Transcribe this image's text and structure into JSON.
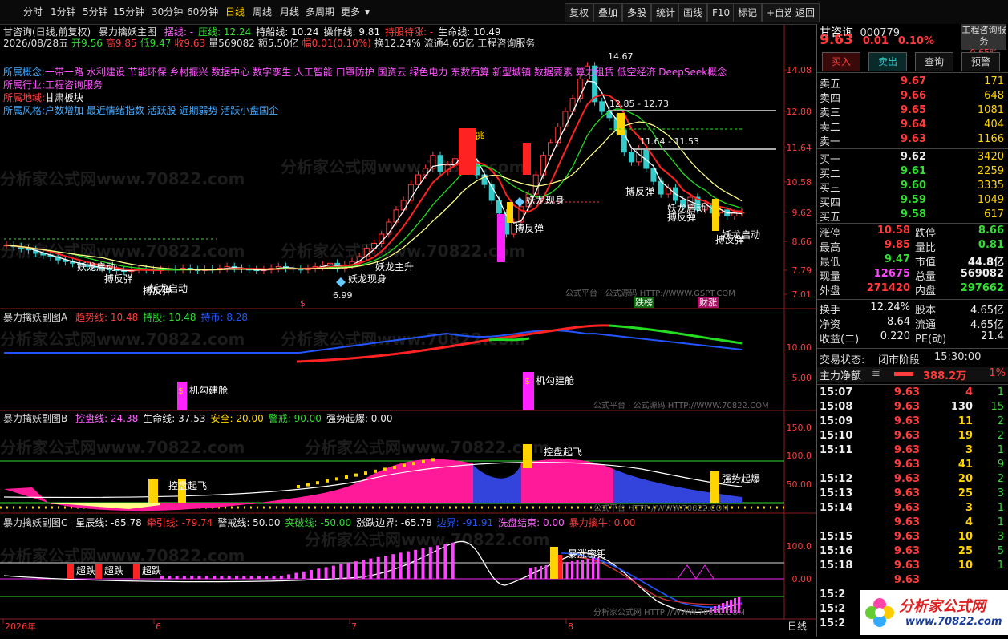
{
  "topbar": {
    "periods": [
      "分时",
      "1分钟",
      "5分钟",
      "15分钟",
      "30分钟",
      "60分钟",
      "日线",
      "周线",
      "月线",
      "多周期",
      "更多"
    ],
    "selected": "日线",
    "tools": [
      "复权",
      "叠加",
      "多股",
      "统计",
      "画线",
      "F10",
      "标记",
      "+自选",
      "返回"
    ],
    "more_arrow": "▾"
  },
  "main_pane": {
    "title_line": "甘咨询(日线,前复权)",
    "indicator_name": "暴力擒妖主图",
    "params": [
      {
        "t": "摆线: -",
        "c": "#ff66ff"
      },
      {
        "t": "压线: 12.24",
        "c": "#33dd33"
      },
      {
        "t": "持船线: 10.24",
        "c": "#eeeeee"
      },
      {
        "t": "操作线: 9.81",
        "c": "#eeeeee"
      },
      {
        "t": "持股待涨: -",
        "c": "#ff3b3b"
      },
      {
        "t": "生命线: 10.49",
        "c": "#eeeeee"
      }
    ],
    "quote_line": [
      {
        "t": "2026/08/28五",
        "c": "#ddd"
      },
      {
        "t": "开9.56",
        "c": "#33dd33"
      },
      {
        "t": "高9.85",
        "c": "#ff3b3b"
      },
      {
        "t": "低9.47",
        "c": "#33dd33"
      },
      {
        "t": "收9.63",
        "c": "#ff3b3b"
      },
      {
        "t": "量569082",
        "c": "#ddd"
      },
      {
        "t": "额5.50亿",
        "c": "#ddd"
      },
      {
        "t": "幅0.01(0.10%)",
        "c": "#ff3b3b"
      },
      {
        "t": "换12.24%",
        "c": "#ddd"
      },
      {
        "t": "流通4.65亿",
        "c": "#ddd"
      },
      {
        "t": "工程咨询服务",
        "c": "#ddd"
      }
    ],
    "concept_label": "所属概念:",
    "concepts": "一带一路 水利建设 节能环保 乡村振兴 数据中心 数字孪生 人工智能 口罩防护 国资云 绿色电力 东数西算 新型城镇 数据要素 算力租赁 低空经济 DeepSeek概念",
    "industry_label": "所属行业:",
    "industry": "工程咨询服务",
    "region_label": "所属地域:",
    "region": "甘肃板块",
    "style_label": "所属风格:",
    "style": "户数增加 最近情绪指数 活跃股 近期弱势 活跃小盘国企",
    "y_ticks": [
      "14.08",
      "12.80",
      "11.64",
      "10.58",
      "9.62",
      "8.66",
      "7.79",
      "7.01"
    ],
    "annotations": {
      "high": "14.67",
      "low": "6.99",
      "range1": "12.85 - 12.73",
      "range2": "11.64 - 11.53",
      "escape": "逃",
      "dragon1": "妖龙现身",
      "dragon2": "妖龙现身",
      "main_rise": "妖龙主升",
      "rebound": "搏反弹",
      "launch": "妖龙启动",
      "dollar": "$",
      "tag1": "跌榜",
      "tag2": "财涨",
      "src": "公式平台 · 公式源码 HTTP://WWW.GSPT.COM"
    }
  },
  "sub_a": {
    "name": "暴力擒妖副图A",
    "params": [
      {
        "t": "趋势线: 10.48",
        "c": "#ff3b3b"
      },
      {
        "t": "持股: 10.48",
        "c": "#33dd33"
      },
      {
        "t": "持币: 8.28",
        "c": "#2255ff"
      }
    ],
    "y_ticks": [
      "10.00",
      "5.00"
    ],
    "label": "机勾建舱",
    "dollar": "$",
    "src": "公式平台 · 公式源码 HTTP://WWW.70822.COM"
  },
  "sub_b": {
    "name": "暴力擒妖副图B",
    "params": [
      {
        "t": "控盘线: 24.38",
        "c": "#ff66ff"
      },
      {
        "t": "生命线: 37.53",
        "c": "#eeeeee"
      },
      {
        "t": "安全: 20.00",
        "c": "#ffd400"
      },
      {
        "t": "警戒: 90.00",
        "c": "#33dd33"
      },
      {
        "t": "强势起爆: 0.00",
        "c": "#eeeeee"
      }
    ],
    "y_ticks": [
      "150.0",
      "100.0",
      "50.00"
    ],
    "label1": "控盘起飞",
    "label2": "强势起爆",
    "src": "公式平台 HTTP://WWW.70822.COM"
  },
  "sub_c": {
    "name": "暴力擒妖副图C",
    "params": [
      {
        "t": "星辰线: -65.78",
        "c": "#eeeeee"
      },
      {
        "t": "牵引线: -79.74",
        "c": "#ff3b3b"
      },
      {
        "t": "警戒线: 50.00",
        "c": "#eeeeee"
      },
      {
        "t": "突破线: -50.00",
        "c": "#33dd33"
      },
      {
        "t": "涨跌边界: -65.78",
        "c": "#eeeeee"
      },
      {
        "t": "边界: -91.91",
        "c": "#2255ff"
      },
      {
        "t": "洗盘结束: 0.00",
        "c": "#ff66ff"
      },
      {
        "t": "暴力擒牛: 0.00",
        "c": "#ff3b3b"
      }
    ],
    "y_ticks": [
      "100.0",
      "0.00"
    ],
    "label_super": "超跌",
    "label_surge": "暴涨密钥",
    "src": "分析家公式网 HTTP://WWW.70822.COM"
  },
  "xaxis": {
    "labels": [
      "2026年",
      "6",
      "7",
      "8"
    ],
    "period": "日线"
  },
  "watermark": "分析家公式网www.70822.com",
  "right_panel": {
    "name": "甘咨询",
    "code": "000779",
    "industry_badge": "工程咨询服务",
    "badge_pct": "0.65%",
    "price": "9.63",
    "change": "0.01",
    "change_pct": "0.10%",
    "buttons": [
      "买入",
      "卖出",
      "查询",
      "预警"
    ],
    "asks": [
      {
        "label": "卖五",
        "price": "9.67",
        "vol": "171",
        "pc": "red"
      },
      {
        "label": "卖四",
        "price": "9.66",
        "vol": "648",
        "pc": "red"
      },
      {
        "label": "卖三",
        "price": "9.65",
        "vol": "1081",
        "pc": "red"
      },
      {
        "label": "卖二",
        "price": "9.64",
        "vol": "404",
        "pc": "red"
      },
      {
        "label": "卖一",
        "price": "9.63",
        "vol": "1166",
        "pc": "red"
      }
    ],
    "bids": [
      {
        "label": "买一",
        "price": "9.62",
        "vol": "3420",
        "pc": "white"
      },
      {
        "label": "买二",
        "price": "9.61",
        "vol": "2259",
        "pc": "green"
      },
      {
        "label": "买三",
        "price": "9.60",
        "vol": "3335",
        "pc": "green"
      },
      {
        "label": "买四",
        "price": "9.59",
        "vol": "1049",
        "pc": "green"
      },
      {
        "label": "买五",
        "price": "9.58",
        "vol": "617",
        "pc": "green"
      }
    ],
    "stats": [
      {
        "l1": "涨停",
        "v1": "10.58",
        "c1": "red",
        "l2": "跌停",
        "v2": "8.66",
        "c2": "green"
      },
      {
        "l1": "最高",
        "v1": "9.85",
        "c1": "red",
        "l2": "量比",
        "v2": "0.81",
        "c2": "green"
      },
      {
        "l1": "最低",
        "v1": "9.47",
        "c1": "green",
        "l2": "市值",
        "v2": "44.8亿",
        "c2": "white"
      },
      {
        "l1": "现量",
        "v1": "12675",
        "c1": "magenta",
        "l2": "总量",
        "v2": "569082",
        "c2": "white"
      },
      {
        "l1": "外盘",
        "v1": "271420",
        "c1": "red",
        "l2": "内盘",
        "v2": "297662",
        "c2": "green"
      }
    ],
    "stats2": [
      {
        "l1": "换手",
        "v1": "12.24%",
        "l2": "股本",
        "v2": "4.65亿"
      },
      {
        "l1": "净资",
        "v1": "8.64",
        "l2": "流通",
        "v2": "4.65亿"
      },
      {
        "l1": "收益(二)",
        "v1": "0.220",
        "l2": "PE(动)",
        "v2": "21.4"
      }
    ],
    "trade_status_label": "交易状态:",
    "trade_status": "闭市阶段",
    "trade_time": "15:30:00",
    "main_net_label": "主力净额",
    "main_net": "388.2万",
    "main_net_pct": "1%",
    "ticks": [
      {
        "t": "15:07",
        "p": "9.63",
        "v": "4",
        "d": "1",
        "vc": "red"
      },
      {
        "t": "15:08",
        "p": "9.63",
        "v": "130",
        "d": "15",
        "vc": "white"
      },
      {
        "t": "15:09",
        "p": "9.63",
        "v": "11",
        "d": "2",
        "vc": "yellow"
      },
      {
        "t": "15:10",
        "p": "9.63",
        "v": "19",
        "d": "2",
        "vc": "yellow"
      },
      {
        "t": "15:11",
        "p": "9.63",
        "v": "3",
        "d": "1",
        "vc": "yellow"
      },
      {
        "t": "",
        "p": "9.63",
        "v": "41",
        "d": "9",
        "vc": "yellow"
      },
      {
        "t": "15:12",
        "p": "9.63",
        "v": "20",
        "d": "2",
        "vc": "yellow"
      },
      {
        "t": "15:13",
        "p": "9.63",
        "v": "25",
        "d": "3",
        "vc": "yellow"
      },
      {
        "t": "15:14",
        "p": "9.63",
        "v": "3",
        "d": "1",
        "vc": "yellow"
      },
      {
        "t": "",
        "p": "9.63",
        "v": "4",
        "d": "1",
        "vc": "yellow"
      },
      {
        "t": "15:15",
        "p": "9.63",
        "v": "10",
        "d": "3",
        "vc": "yellow"
      },
      {
        "t": "15:16",
        "p": "9.63",
        "v": "25",
        "d": "5",
        "vc": "yellow"
      },
      {
        "t": "15:18",
        "p": "9.63",
        "v": "10",
        "d": "1",
        "vc": "yellow"
      },
      {
        "t": "",
        "p": "9.63",
        "v": "",
        "d": "",
        "vc": "yellow"
      },
      {
        "t": "15:2",
        "p": "",
        "v": "",
        "d": "",
        "vc": "yellow"
      },
      {
        "t": "15:2",
        "p": "",
        "v": "",
        "d": "",
        "vc": "yellow"
      },
      {
        "t": "15:2",
        "p": "",
        "v": "",
        "d": "",
        "vc": "yellow"
      }
    ],
    "logo_text": "分析家公式网",
    "logo_url": "www.70822.com"
  }
}
